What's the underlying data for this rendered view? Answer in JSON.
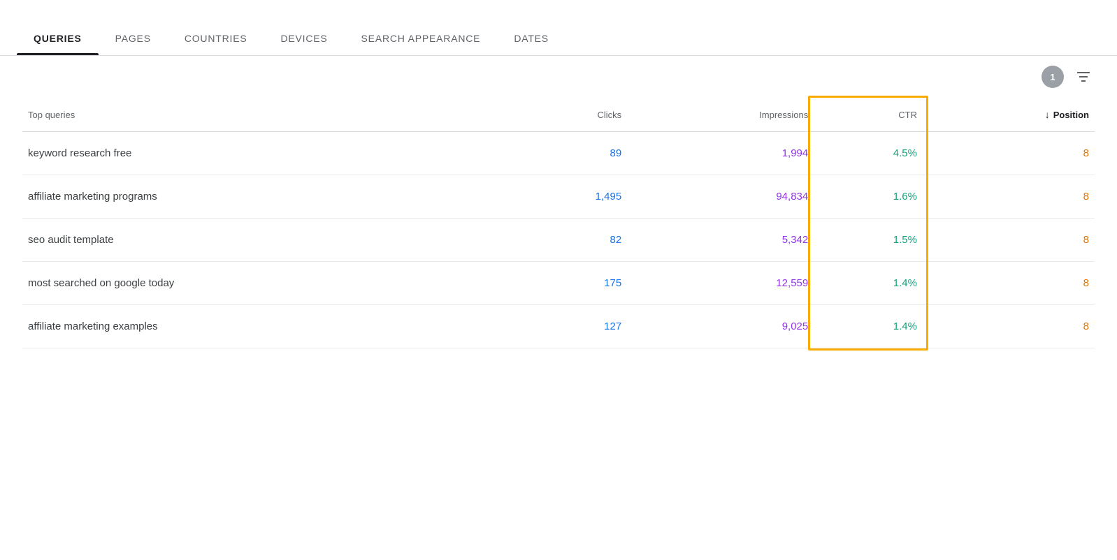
{
  "tabs": [
    {
      "id": "queries",
      "label": "QUERIES",
      "active": true
    },
    {
      "id": "pages",
      "label": "PAGES",
      "active": false
    },
    {
      "id": "countries",
      "label": "COUNTRIES",
      "active": false
    },
    {
      "id": "devices",
      "label": "DEVICES",
      "active": false
    },
    {
      "id": "search-appearance",
      "label": "SEARCH APPEARANCE",
      "active": false
    },
    {
      "id": "dates",
      "label": "DATES",
      "active": false
    }
  ],
  "toolbar": {
    "filter_count": "1",
    "filter_icon_label": "filter"
  },
  "table": {
    "columns": {
      "query": "Top queries",
      "clicks": "Clicks",
      "impressions": "Impressions",
      "ctr": "CTR",
      "position": "Position"
    },
    "rows": [
      {
        "query": "keyword research free",
        "clicks": "89",
        "impressions": "1,994",
        "ctr": "4.5%",
        "position": "8"
      },
      {
        "query": "affiliate marketing programs",
        "clicks": "1,495",
        "impressions": "94,834",
        "ctr": "1.6%",
        "position": "8"
      },
      {
        "query": "seo audit template",
        "clicks": "82",
        "impressions": "5,342",
        "ctr": "1.5%",
        "position": "8"
      },
      {
        "query": "most searched on google today",
        "clicks": "175",
        "impressions": "12,559",
        "ctr": "1.4%",
        "position": "8"
      },
      {
        "query": "affiliate marketing examples",
        "clicks": "127",
        "impressions": "9,025",
        "ctr": "1.4%",
        "position": "8"
      }
    ]
  },
  "colors": {
    "clicks": "#1a73e8",
    "impressions": "#9334e6",
    "ctr": "#12a37a",
    "position": "#e37400",
    "ctr_highlight_border": "#f9ab00",
    "active_tab_underline": "#202124"
  }
}
